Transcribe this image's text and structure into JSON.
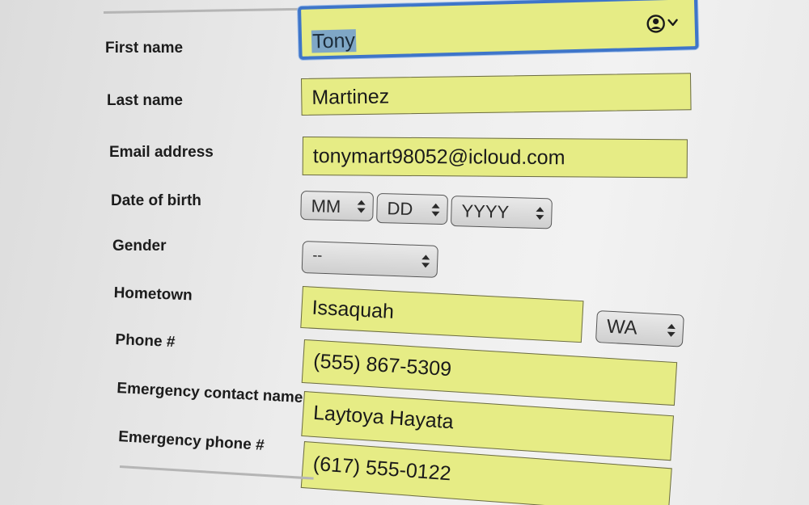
{
  "form": {
    "first_name": {
      "label": "First name",
      "value": "Tony"
    },
    "last_name": {
      "label": "Last name",
      "value": "Martinez"
    },
    "email": {
      "label": "Email address",
      "value": "tonymart98052@icloud.com"
    },
    "dob": {
      "label": "Date of birth",
      "month": "MM",
      "day": "DD",
      "year": "YYYY"
    },
    "gender": {
      "label": "Gender",
      "value": "--"
    },
    "hometown": {
      "label": "Hometown",
      "value": "Issaquah",
      "state": "WA"
    },
    "phone": {
      "label": "Phone #",
      "value": "(555) 867-5309"
    },
    "emergency_name": {
      "label": "Emergency contact name",
      "value": "Laytoya Hayata"
    },
    "emergency_phone": {
      "label": "Emergency phone #",
      "value": "(617) 555-0122"
    }
  },
  "icons": {
    "autofill": "person-circle-icon",
    "autofill_menu": "chevron-down-icon",
    "select_arrows": "up-down-arrows-icon"
  },
  "colors": {
    "autofill_background": "#e6ec85",
    "focus_ring": "#3e75c9",
    "text_selection": "#7fa7c6"
  }
}
